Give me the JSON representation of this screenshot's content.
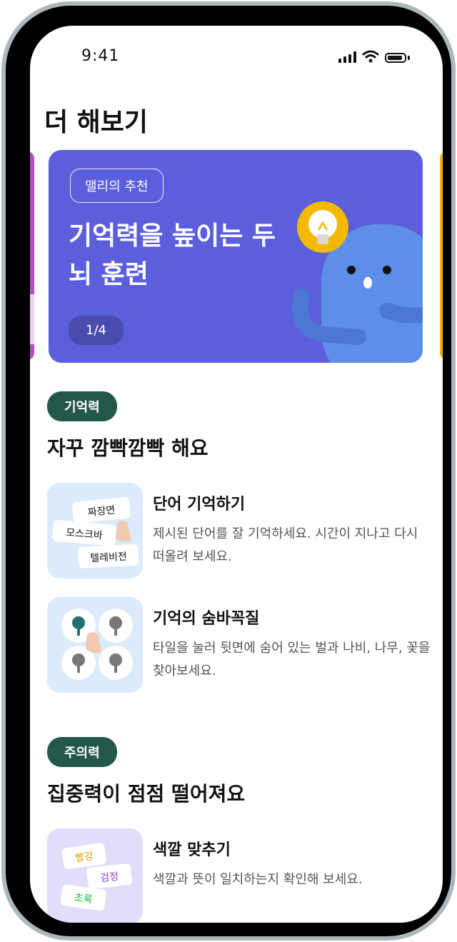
{
  "status": {
    "time": "9:41"
  },
  "page": {
    "title": "더 해보기"
  },
  "banner": {
    "chip": "맬리의 추천",
    "title": "기억력을 높이는 두뇌 훈련",
    "page": "1/4"
  },
  "sections": [
    {
      "badge": "기억력",
      "title": "자꾸 깜빡깜빡 해요",
      "items": [
        {
          "title": "단어 기억하기",
          "desc": "제시된 단어를 잘 기억하세요. 시간이 지나고 다시 떠올려 보세요.",
          "words": [
            "짜장면",
            "모스크바",
            "텔레비전"
          ]
        },
        {
          "title": "기억의 숨바꼭질",
          "desc": "타일을 눌러 뒷면에 숨어 있는 벌과 나비, 나무, 꽃을 찾아보세요."
        }
      ]
    },
    {
      "badge": "주의력",
      "title": "집중력이 점점 떨어져요",
      "items": [
        {
          "title": "색깔 맞추기",
          "desc": "색깔과 뜻이 일치하는지 확인해 보세요.",
          "words": [
            "빨강",
            "검정",
            "초록"
          ]
        }
      ]
    }
  ],
  "colors": {
    "banner_bg": "#5b5fdc",
    "badge_bg": "#22574a",
    "thumb_blue": "#dbeafc",
    "thumb_purple": "#e3dcfb",
    "peek_left": "#b54cc4",
    "peek_right": "#f2b400"
  }
}
